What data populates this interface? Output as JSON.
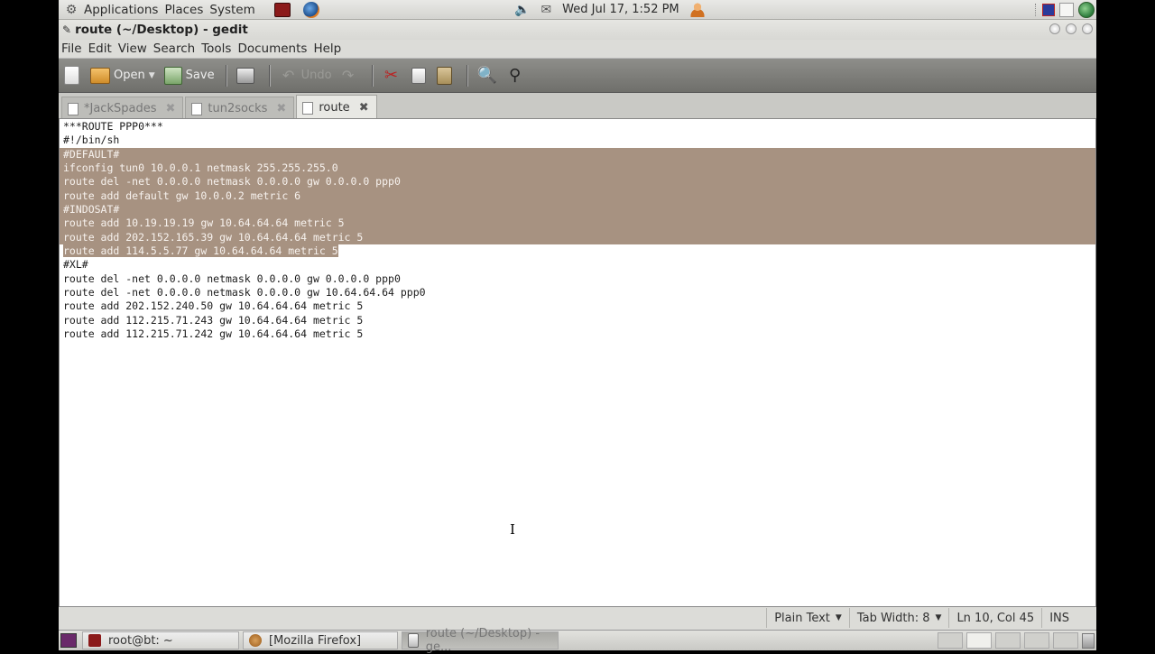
{
  "top_panel": {
    "applications_label": "Applications",
    "places_label": "Places",
    "system_label": "System",
    "clock": "Wed Jul 17,  1:52 PM"
  },
  "window": {
    "title": "route (~/Desktop) - gedit",
    "menus": [
      "File",
      "Edit",
      "View",
      "Search",
      "Tools",
      "Documents",
      "Help"
    ],
    "toolbar": {
      "open_label": "Open",
      "save_label": "Save",
      "undo_label": "Undo"
    },
    "tabs": [
      {
        "label": "*JackSpades"
      },
      {
        "label": "tun2socks"
      },
      {
        "label": "route"
      }
    ],
    "active_tab": "route",
    "lines": [
      "***ROUTE PPP0***",
      "#!/bin/sh",
      "#DEFAULT#",
      "ifconfig tun0 10.0.0.1 netmask 255.255.255.0",
      "route del -net 0.0.0.0 netmask 0.0.0.0 gw 0.0.0.0 ppp0",
      "route add default gw 10.0.0.2 metric 6",
      "#INDOSAT#",
      "route add 10.19.19.19 gw 10.64.64.64 metric 5",
      "route add 202.152.165.39 gw 10.64.64.64 metric 5",
      "route add 114.5.5.77 gw 10.64.64.64 metric 5",
      "#XL#",
      "route del -net 0.0.0.0 netmask 0.0.0.0 gw 0.0.0.0 ppp0",
      "route del -net 0.0.0.0 netmask 0.0.0.0 gw 10.64.64.64 ppp0",
      "route add 202.152.240.50 gw 10.64.64.64 metric 5",
      "route add 112.215.71.243 gw 10.64.64.64 metric 5",
      "route add 112.215.71.242 gw 10.64.64.64 metric 5"
    ],
    "selected_lines": [
      3,
      10
    ],
    "status": {
      "language": "Plain Text",
      "tab_width": "Tab Width:  8",
      "position": "Ln 10, Col 45",
      "mode": "INS"
    },
    "selection_color": "#a79281"
  },
  "taskbar": {
    "tasks": [
      {
        "label": "root@bt: ~",
        "icon": "terminal-icon"
      },
      {
        "label": "[Mozilla Firefox]",
        "icon": "firefox-icon"
      },
      {
        "label": "route (~/Desktop) - ge...",
        "icon": "gedit-icon"
      }
    ]
  }
}
